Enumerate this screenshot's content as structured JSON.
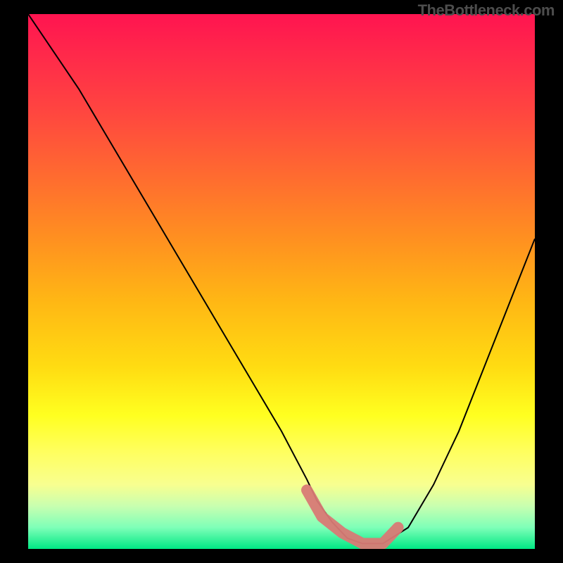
{
  "watermark": "TheBottleneck.com",
  "chart_data": {
    "type": "line",
    "title": "",
    "xlabel": "",
    "ylabel": "",
    "xlim": [
      0,
      100
    ],
    "ylim": [
      0,
      100
    ],
    "grid": false,
    "legend": false,
    "series": [
      {
        "name": "bottleneck-curve",
        "x": [
          0,
          5,
          10,
          15,
          20,
          25,
          30,
          35,
          40,
          45,
          50,
          55,
          57,
          60,
          63,
          66,
          70,
          75,
          80,
          85,
          90,
          95,
          100
        ],
        "values": [
          100,
          93,
          86,
          78,
          70,
          62,
          54,
          46,
          38,
          30,
          22,
          13,
          9,
          5,
          2,
          1,
          1,
          4,
          12,
          22,
          34,
          46,
          58
        ]
      }
    ],
    "highlight": {
      "name": "optimal-range",
      "x": [
        55,
        58,
        62,
        66,
        70,
        73
      ],
      "values": [
        11,
        6,
        3,
        1,
        1,
        4
      ]
    },
    "gradient_stops": [
      {
        "pos": 0.0,
        "color": "#ff1450"
      },
      {
        "pos": 0.18,
        "color": "#ff4540"
      },
      {
        "pos": 0.42,
        "color": "#ff9020"
      },
      {
        "pos": 0.66,
        "color": "#ffdc12"
      },
      {
        "pos": 0.82,
        "color": "#ffff60"
      },
      {
        "pos": 0.92,
        "color": "#c8ffb0"
      },
      {
        "pos": 1.0,
        "color": "#00e884"
      }
    ]
  }
}
